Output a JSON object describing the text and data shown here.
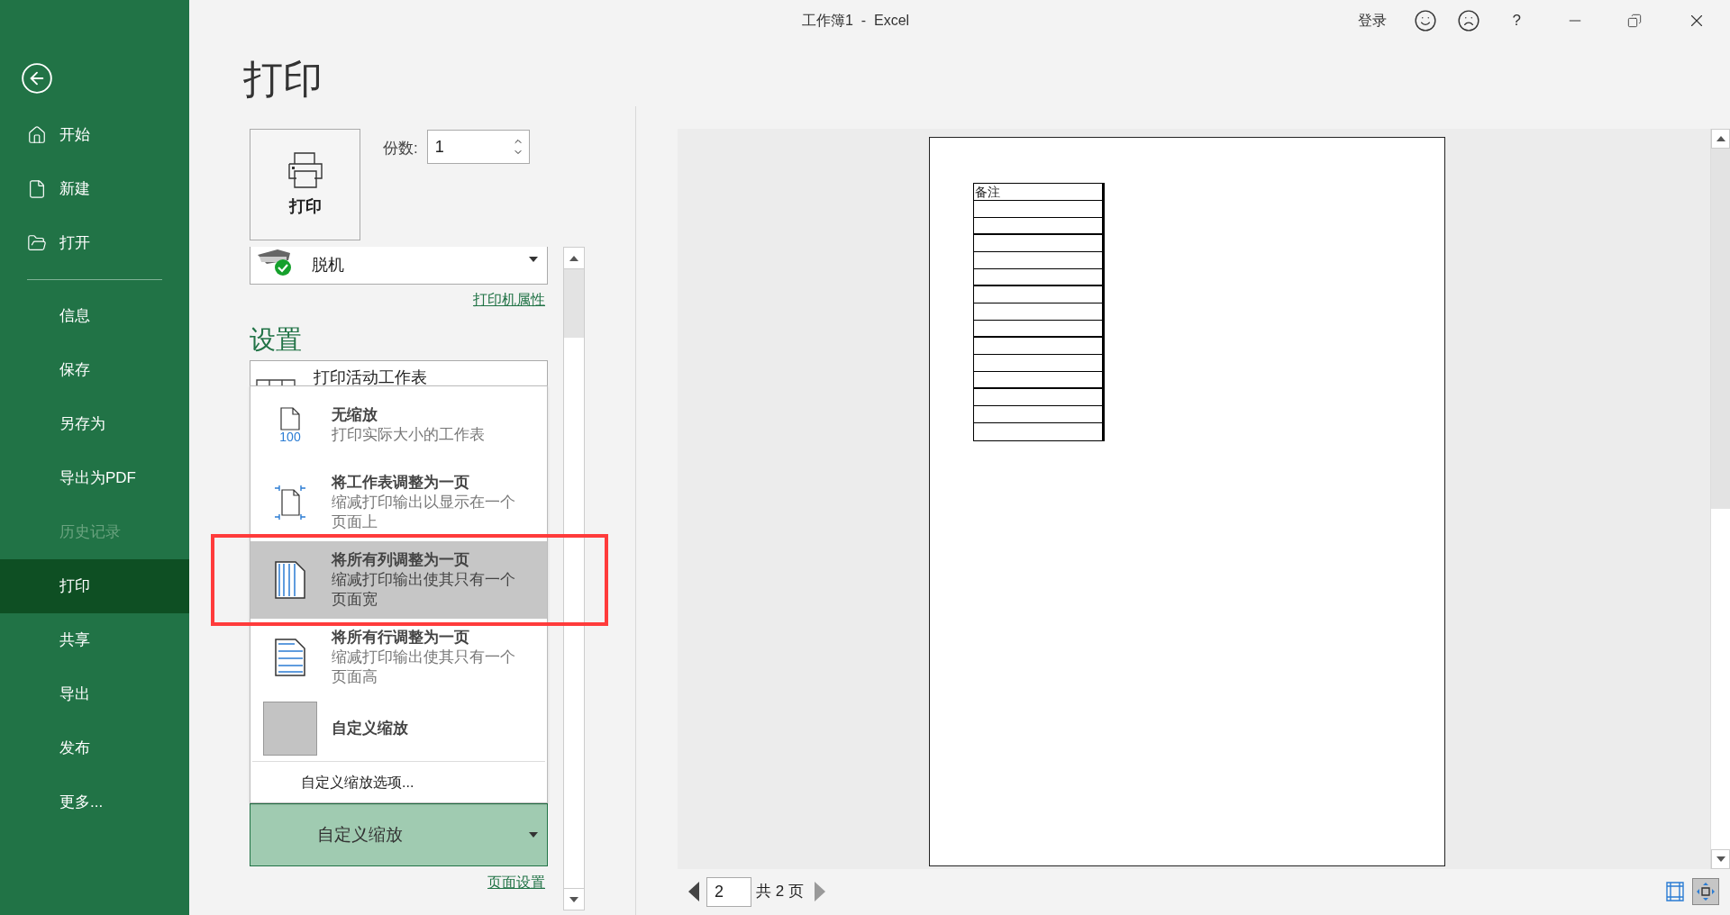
{
  "window": {
    "title": "工作簿1  -  Excel",
    "signin": "登录",
    "help": "?"
  },
  "sidebar": {
    "top_items": [
      {
        "label": "开始",
        "kind": "home",
        "selected": false,
        "disabled": false
      },
      {
        "label": "新建",
        "kind": "new",
        "selected": false,
        "disabled": false
      },
      {
        "label": "打开",
        "kind": "open",
        "selected": false,
        "disabled": false
      }
    ],
    "items": [
      {
        "label": "信息",
        "selected": false,
        "disabled": false
      },
      {
        "label": "保存",
        "selected": false,
        "disabled": false
      },
      {
        "label": "另存为",
        "selected": false,
        "disabled": false
      },
      {
        "label": "导出为PDF",
        "selected": false,
        "disabled": false
      },
      {
        "label": "历史记录",
        "selected": false,
        "disabled": true
      },
      {
        "label": "打印",
        "selected": true,
        "disabled": false
      },
      {
        "label": "共享",
        "selected": false,
        "disabled": false
      },
      {
        "label": "导出",
        "selected": false,
        "disabled": false
      },
      {
        "label": "发布",
        "selected": false,
        "disabled": false
      },
      {
        "label": "更多...",
        "selected": false,
        "disabled": false
      }
    ]
  },
  "print": {
    "title": "打印",
    "button": "打印",
    "copies_label": "份数:",
    "copies": "1"
  },
  "printer": {
    "name": "脱机",
    "properties_link": "打印机属性"
  },
  "settings": {
    "heading": "设置",
    "scope": "打印活动工作表",
    "scaling_menu": [
      {
        "kind": "no-scaling",
        "title": "无缩放",
        "description": "打印实际大小的工作表",
        "icon_text": "100",
        "selected": false
      },
      {
        "kind": "fit-sheet",
        "title": "将工作表调整为一页",
        "description": "缩减打印输出以显示在一个页面上",
        "selected": false
      },
      {
        "kind": "fit-columns",
        "title": "将所有列调整为一页",
        "description": "缩减打印输出使其只有一个页面宽",
        "selected": true
      },
      {
        "kind": "fit-rows",
        "title": "将所有行调整为一页",
        "description": "缩减打印输出使其只有一个页面高",
        "selected": false
      },
      {
        "kind": "custom",
        "title": "自定义缩放",
        "selected": false
      }
    ],
    "menu_footer": "自定义缩放选项...",
    "scaling_value": "自定义缩放",
    "page_setup_link": "页面设置"
  },
  "preview": {
    "table_header": "备注",
    "page": "2",
    "page_total": "共 2 页"
  }
}
